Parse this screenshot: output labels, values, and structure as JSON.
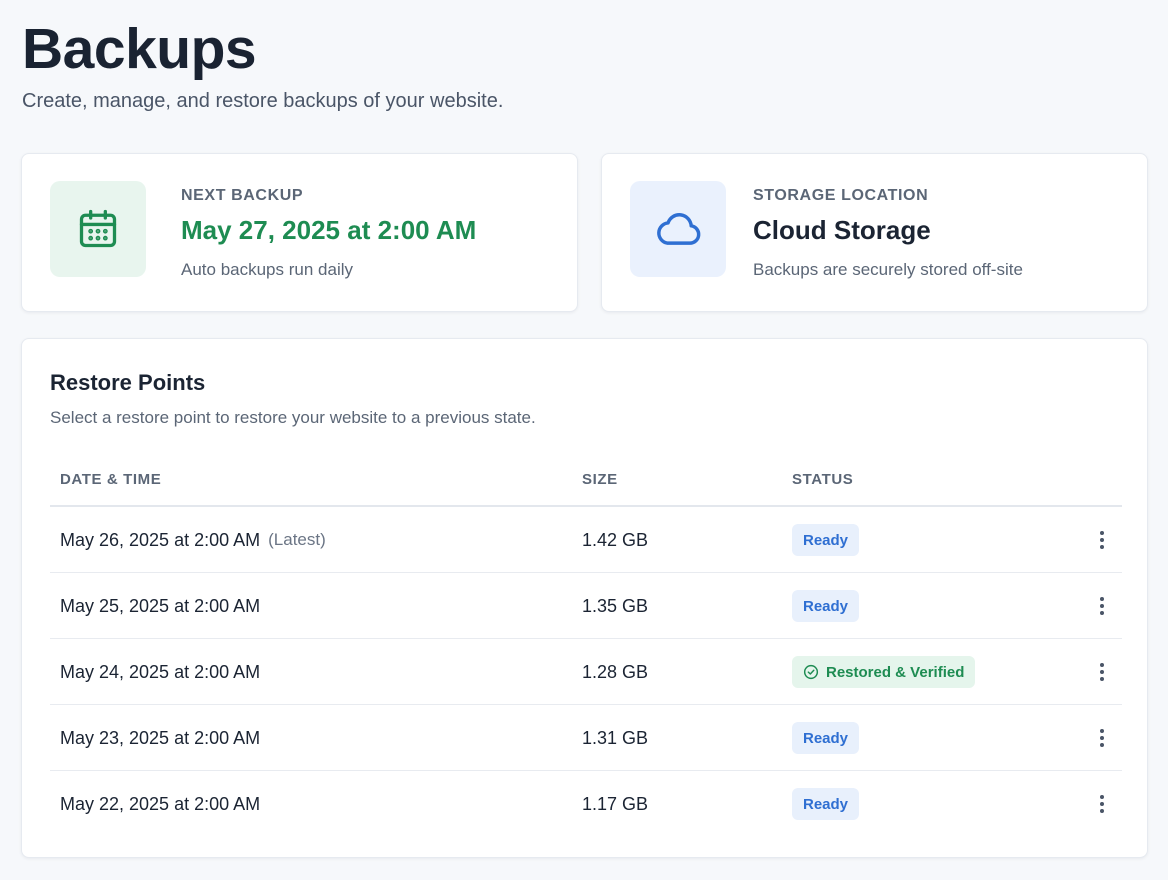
{
  "header": {
    "title": "Backups",
    "subtitle": "Create, manage, and restore backups of your website."
  },
  "next_backup": {
    "label": "NEXT BACKUP",
    "value": "May 27, 2025 at 2:00 AM",
    "description": "Auto backups run daily",
    "icon": "calendar-icon",
    "accent": "#1e8c52"
  },
  "storage": {
    "label": "STORAGE LOCATION",
    "value": "Cloud Storage",
    "description": "Backups are securely stored off-site",
    "icon": "cloud-icon",
    "accent": "#2f6fd2"
  },
  "restore_points": {
    "title": "Restore Points",
    "description": "Select a restore point to restore your website to a previous state.",
    "columns": {
      "date": "DATE & TIME",
      "size": "SIZE",
      "status": "STATUS"
    },
    "rows": [
      {
        "date": "May 26, 2025 at 2:00 AM",
        "tag": "(Latest)",
        "size": "1.42 GB",
        "status": "Ready"
      },
      {
        "date": "May 25, 2025 at 2:00 AM",
        "tag": "",
        "size": "1.35 GB",
        "status": "Ready"
      },
      {
        "date": "May 24, 2025 at 2:00 AM",
        "tag": "",
        "size": "1.28 GB",
        "status": "Restored & Verified"
      },
      {
        "date": "May 23, 2025 at 2:00 AM",
        "tag": "",
        "size": "1.31 GB",
        "status": "Ready"
      },
      {
        "date": "May 22, 2025 at 2:00 AM",
        "tag": "",
        "size": "1.17 GB",
        "status": "Ready"
      }
    ]
  }
}
